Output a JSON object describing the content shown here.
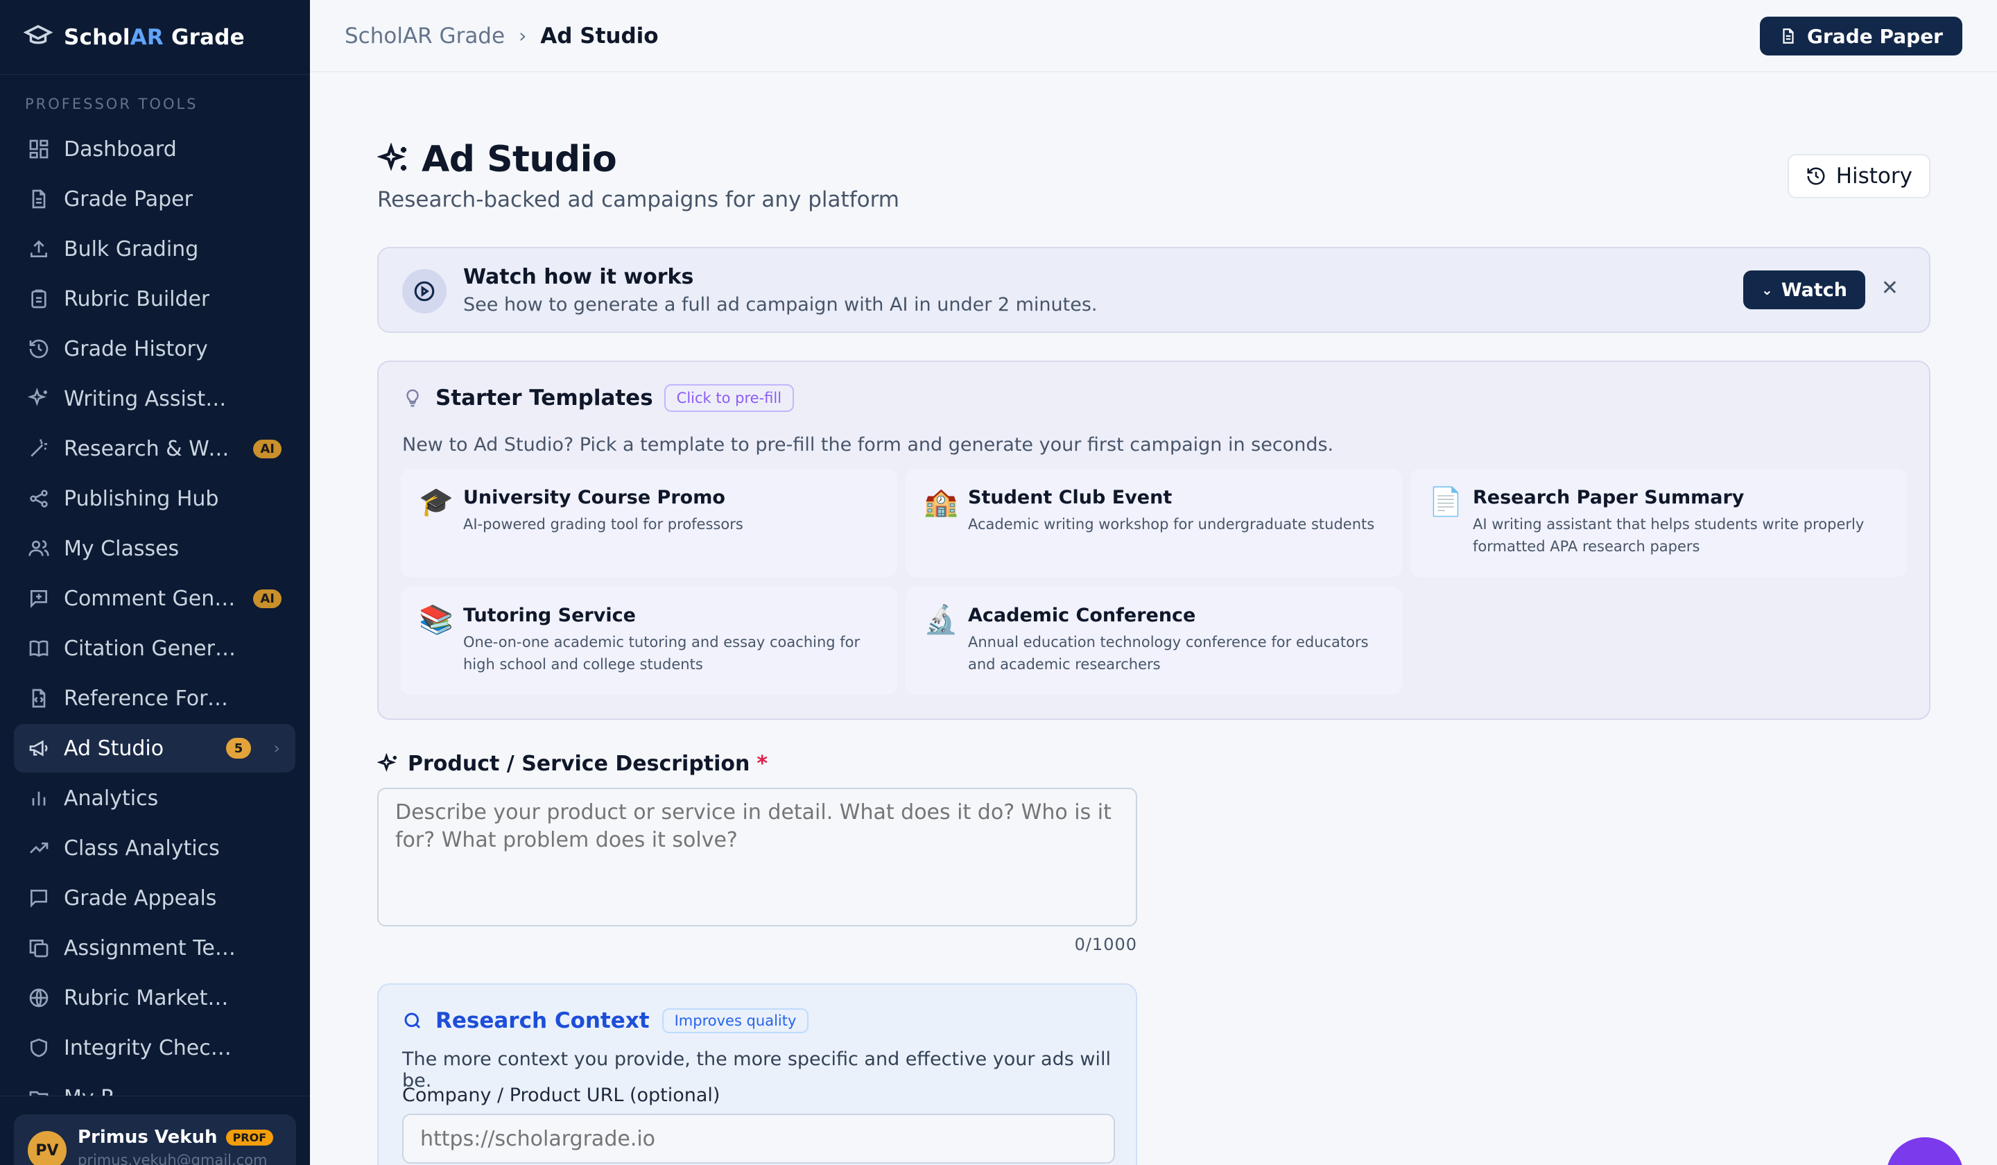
{
  "brand": {
    "prefix": "Schol",
    "accent": "AR",
    "suffix": " Grade"
  },
  "sidebar": {
    "section_label": "PROFESSOR TOOLS",
    "items": [
      {
        "label": "Dashboard",
        "icon": "dashboard-icon"
      },
      {
        "label": "Grade Paper",
        "icon": "document-icon"
      },
      {
        "label": "Bulk Grading",
        "icon": "upload-icon"
      },
      {
        "label": "Rubric Builder",
        "icon": "clipboard-icon"
      },
      {
        "label": "Grade History",
        "icon": "history-icon"
      },
      {
        "label": "Writing Assistant",
        "icon": "sparkle-icon"
      },
      {
        "label": "Research & Wri...",
        "icon": "wand-icon",
        "badge": "AI"
      },
      {
        "label": "Publishing Hub",
        "icon": "share-icon"
      },
      {
        "label": "My Classes",
        "icon": "users-icon"
      },
      {
        "label": "Comment Gene...",
        "icon": "comment-plus-icon",
        "badge": "AI"
      },
      {
        "label": "Citation Generator",
        "icon": "book-icon"
      },
      {
        "label": "Reference Formatter",
        "icon": "file-code-icon"
      },
      {
        "label": "Ad Studio",
        "icon": "megaphone-icon",
        "count": "5",
        "active": true
      },
      {
        "label": "Analytics",
        "icon": "bar-chart-icon"
      },
      {
        "label": "Class Analytics",
        "icon": "trend-icon"
      },
      {
        "label": "Grade Appeals",
        "icon": "message-icon"
      },
      {
        "label": "Assignment Templa...",
        "icon": "copy-icon"
      },
      {
        "label": "Rubric Marketplace",
        "icon": "globe-icon"
      },
      {
        "label": "Integrity Checker",
        "icon": "shield-icon"
      },
      {
        "label": "My R...",
        "icon": "folder-icon"
      }
    ]
  },
  "user": {
    "initials": "PV",
    "name": "Primus Vekuh",
    "badge": "PROF",
    "email": "primus.vekuh@gmail.com"
  },
  "header": {
    "breadcrumb_root": "ScholAR Grade",
    "breadcrumb_sep": "›",
    "breadcrumb_current": "Ad Studio",
    "grade_button": "Grade Paper"
  },
  "page": {
    "title": "Ad Studio",
    "subtitle": "Research-backed ad campaigns for any platform",
    "history_button": "History"
  },
  "watch": {
    "title": "Watch how it works",
    "description": "See how to generate a full ad campaign with AI in under 2 minutes.",
    "button": "Watch",
    "close": "✕"
  },
  "templates": {
    "title": "Starter Templates",
    "pill": "Click to pre-fill",
    "description": "New to Ad Studio? Pick a template to pre-fill the form and generate your first campaign in seconds.",
    "cards": [
      {
        "emoji": "🎓",
        "name": "University Course Promo",
        "desc": "AI-powered grading tool for professors"
      },
      {
        "emoji": "🏫",
        "name": "Student Club Event",
        "desc": "Academic writing workshop for undergraduate students"
      },
      {
        "emoji": "📄",
        "name": "Research Paper Summary",
        "desc": "AI writing assistant that helps students write properly formatted APA research papers"
      },
      {
        "emoji": "📚",
        "name": "Tutoring Service",
        "desc": "One-on-one academic tutoring and essay coaching for high school and college students"
      },
      {
        "emoji": "🔬",
        "name": "Academic Conference",
        "desc": "Annual education technology conference for educators and academic researchers"
      }
    ]
  },
  "product": {
    "label": "Product / Service Description",
    "required": "*",
    "placeholder": "Describe your product or service in detail. What does it do? Who is it for? What problem does it solve?",
    "char_count": "0/1000"
  },
  "research": {
    "title": "Research Context",
    "pill": "Improves quality",
    "description": "The more context you provide, the more specific and effective your ads will be.",
    "url_label": "Company / Product URL (optional)",
    "url_placeholder": "https://scholargrade.io"
  },
  "colors": {
    "sidebar_bg": "#0c1a33",
    "primary": "#12284a",
    "accent_blue": "#60a5fa",
    "ai_badge": "#c9902c",
    "purple": "#8b5cf6"
  }
}
